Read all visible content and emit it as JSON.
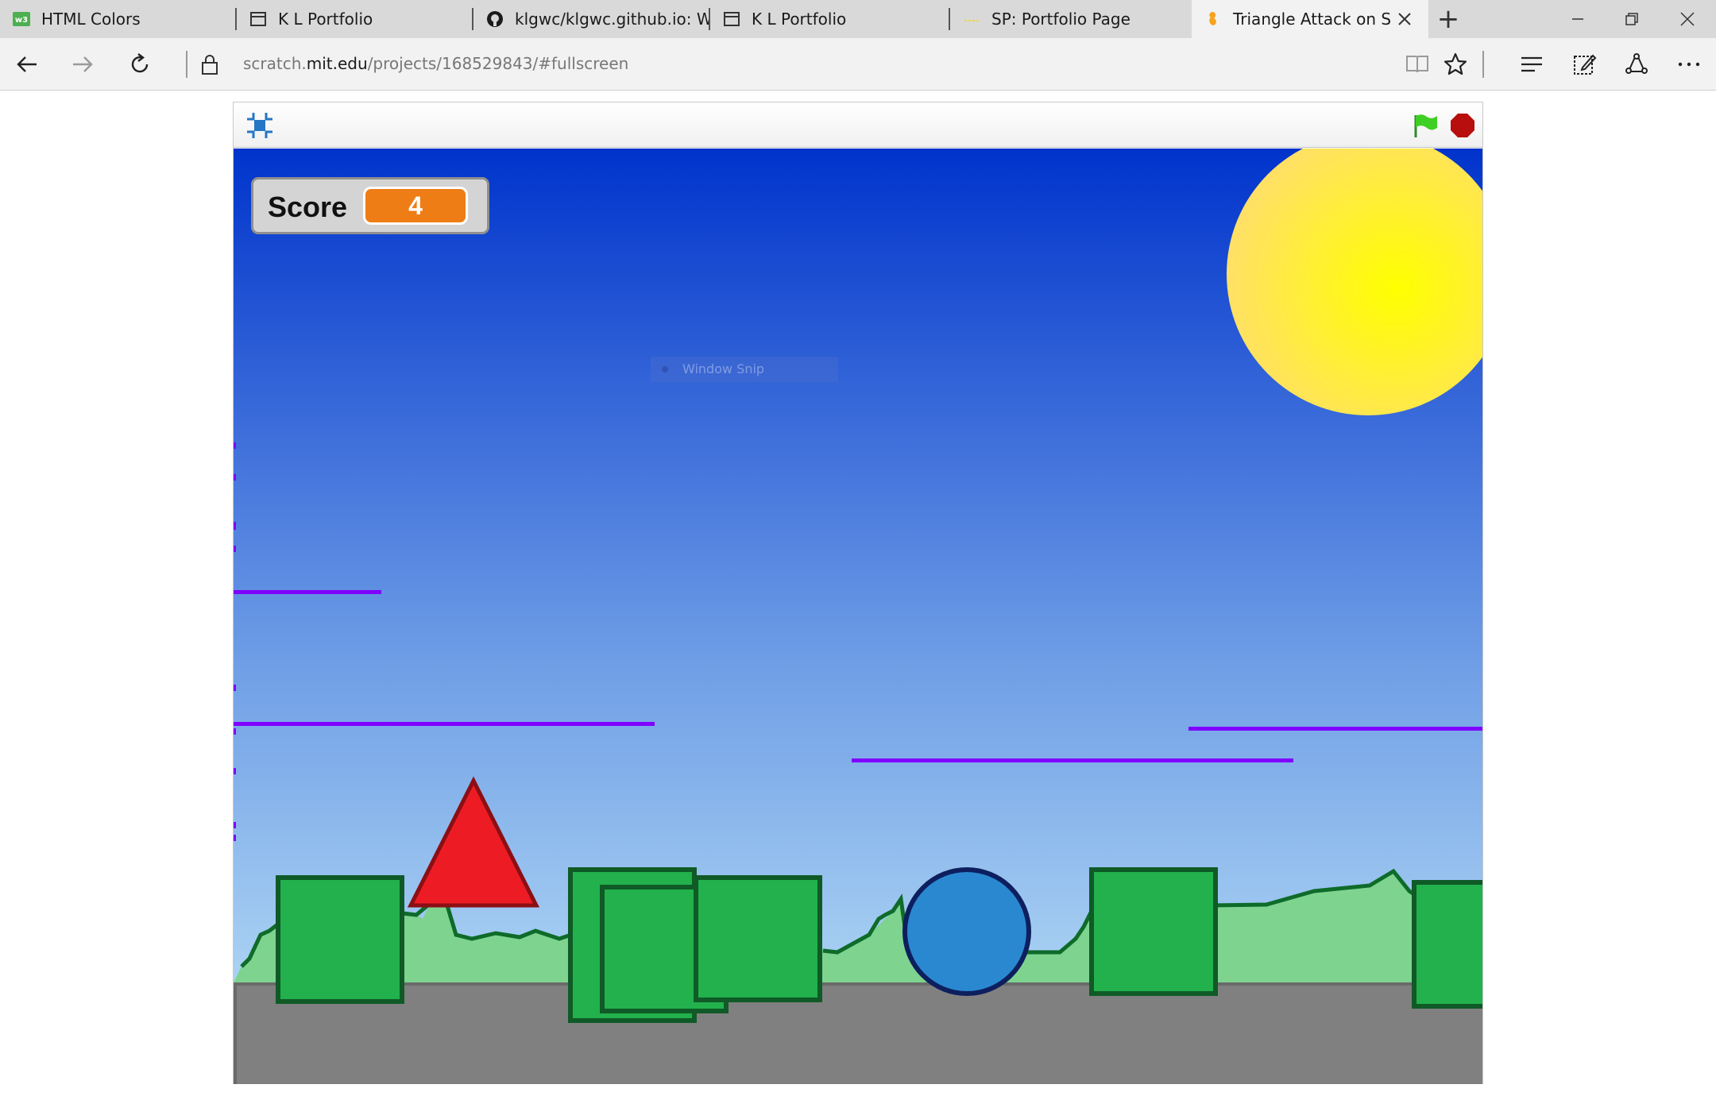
{
  "tabs": [
    {
      "title": "HTML Colors",
      "icon": "w3-favicon-icon"
    },
    {
      "title": "K L Portfolio",
      "icon": "page-icon"
    },
    {
      "title": "klgwc/klgwc.github.io: Welc",
      "icon": "github-icon"
    },
    {
      "title": "K L Portfolio",
      "icon": "page-icon"
    },
    {
      "title": "SP: Portfolio Page",
      "icon": "sp-favicon-icon"
    },
    {
      "title": "Triangle Attack on Scrat",
      "icon": "scratch-favicon-icon",
      "active": true
    }
  ],
  "address_bar": {
    "url_prefix": "scratch.",
    "url_host": "mit.edu",
    "url_path": "/projects/168529843/#fullscreen"
  },
  "game": {
    "score_label": "Score",
    "score_value": "4",
    "overlay_text": "Window Snip"
  },
  "colors": {
    "sky_top": "#0033cc",
    "sky_bottom": "#bde3f7",
    "sun": "#ffff00",
    "ground": "#808080",
    "hills": "#7ed38f",
    "block": "#22b14c",
    "block_border": "#0f5a26",
    "triangle": "#ed1c24",
    "circle": "#2a88d0",
    "platform": "#7f00ff",
    "score_value_bg": "#ee7d16"
  }
}
